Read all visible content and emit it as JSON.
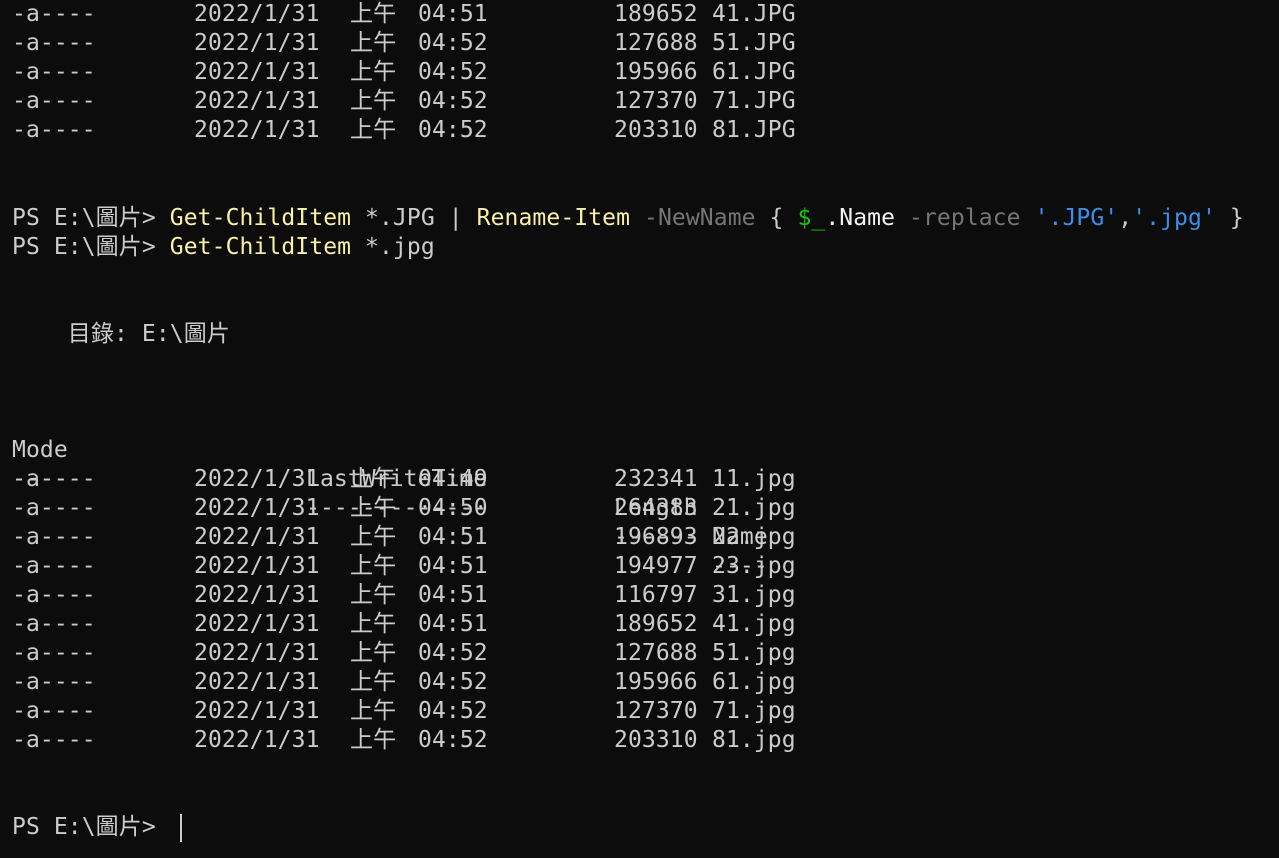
{
  "terminal": {
    "prev_rows": [
      {
        "mode": "-a----",
        "date": "2022/1/31",
        "ampm": "上午",
        "time": "04:51",
        "length": "189652",
        "name": "41.JPG"
      },
      {
        "mode": "-a----",
        "date": "2022/1/31",
        "ampm": "上午",
        "time": "04:52",
        "length": "127688",
        "name": "51.JPG"
      },
      {
        "mode": "-a----",
        "date": "2022/1/31",
        "ampm": "上午",
        "time": "04:52",
        "length": "195966",
        "name": "61.JPG"
      },
      {
        "mode": "-a----",
        "date": "2022/1/31",
        "ampm": "上午",
        "time": "04:52",
        "length": "127370",
        "name": "71.JPG"
      },
      {
        "mode": "-a----",
        "date": "2022/1/31",
        "ampm": "上午",
        "time": "04:52",
        "length": "203310",
        "name": "81.JPG"
      }
    ],
    "prompt": "PS E:\\圖片> ",
    "cmd1": {
      "cmdlet1": "Get-ChildItem",
      "arg1": " *.JPG | ",
      "cmdlet2": "Rename-Item",
      "sp1": " ",
      "param1": "-NewName",
      "brace_open": " { ",
      "var": "$_",
      "member": ".Name ",
      "param2": "-replace",
      "sp2": " ",
      "str1": "'.JPG'",
      "comma": ",",
      "str2": "'.jpg'",
      "brace_close": " }"
    },
    "cmd2": {
      "cmdlet": "Get-ChildItem",
      "arg": " *.jpg"
    },
    "directory_label": "    目錄: E:\\圖片",
    "headers": {
      "mode": "Mode",
      "lastwritetime": "LastWriteTime",
      "length": "Length",
      "name": "Name"
    },
    "underlines": {
      "mode": "----",
      "lastwritetime": "-------------",
      "length": "------",
      "name": "----"
    },
    "rows": [
      {
        "mode": "-a----",
        "date": "2022/1/31",
        "ampm": "上午",
        "time": "04:49",
        "length": "232341",
        "name": "11.jpg"
      },
      {
        "mode": "-a----",
        "date": "2022/1/31",
        "ampm": "上午",
        "time": "04:50",
        "length": "264383",
        "name": "21.jpg"
      },
      {
        "mode": "-a----",
        "date": "2022/1/31",
        "ampm": "上午",
        "time": "04:51",
        "length": "196893",
        "name": "22.jpg"
      },
      {
        "mode": "-a----",
        "date": "2022/1/31",
        "ampm": "上午",
        "time": "04:51",
        "length": "194977",
        "name": "23.jpg"
      },
      {
        "mode": "-a----",
        "date": "2022/1/31",
        "ampm": "上午",
        "time": "04:51",
        "length": "116797",
        "name": "31.jpg"
      },
      {
        "mode": "-a----",
        "date": "2022/1/31",
        "ampm": "上午",
        "time": "04:51",
        "length": "189652",
        "name": "41.jpg"
      },
      {
        "mode": "-a----",
        "date": "2022/1/31",
        "ampm": "上午",
        "time": "04:52",
        "length": "127688",
        "name": "51.jpg"
      },
      {
        "mode": "-a----",
        "date": "2022/1/31",
        "ampm": "上午",
        "time": "04:52",
        "length": "195966",
        "name": "61.jpg"
      },
      {
        "mode": "-a----",
        "date": "2022/1/31",
        "ampm": "上午",
        "time": "04:52",
        "length": "127370",
        "name": "71.jpg"
      },
      {
        "mode": "-a----",
        "date": "2022/1/31",
        "ampm": "上午",
        "time": "04:52",
        "length": "203310",
        "name": "81.jpg"
      }
    ],
    "colors": {
      "background": "#0c0c0c",
      "foreground": "#cccccc",
      "cmdlet": "#f9f1a5",
      "parameter": "#767676",
      "variable": "#16c60c",
      "string": "#3b8eea"
    }
  }
}
